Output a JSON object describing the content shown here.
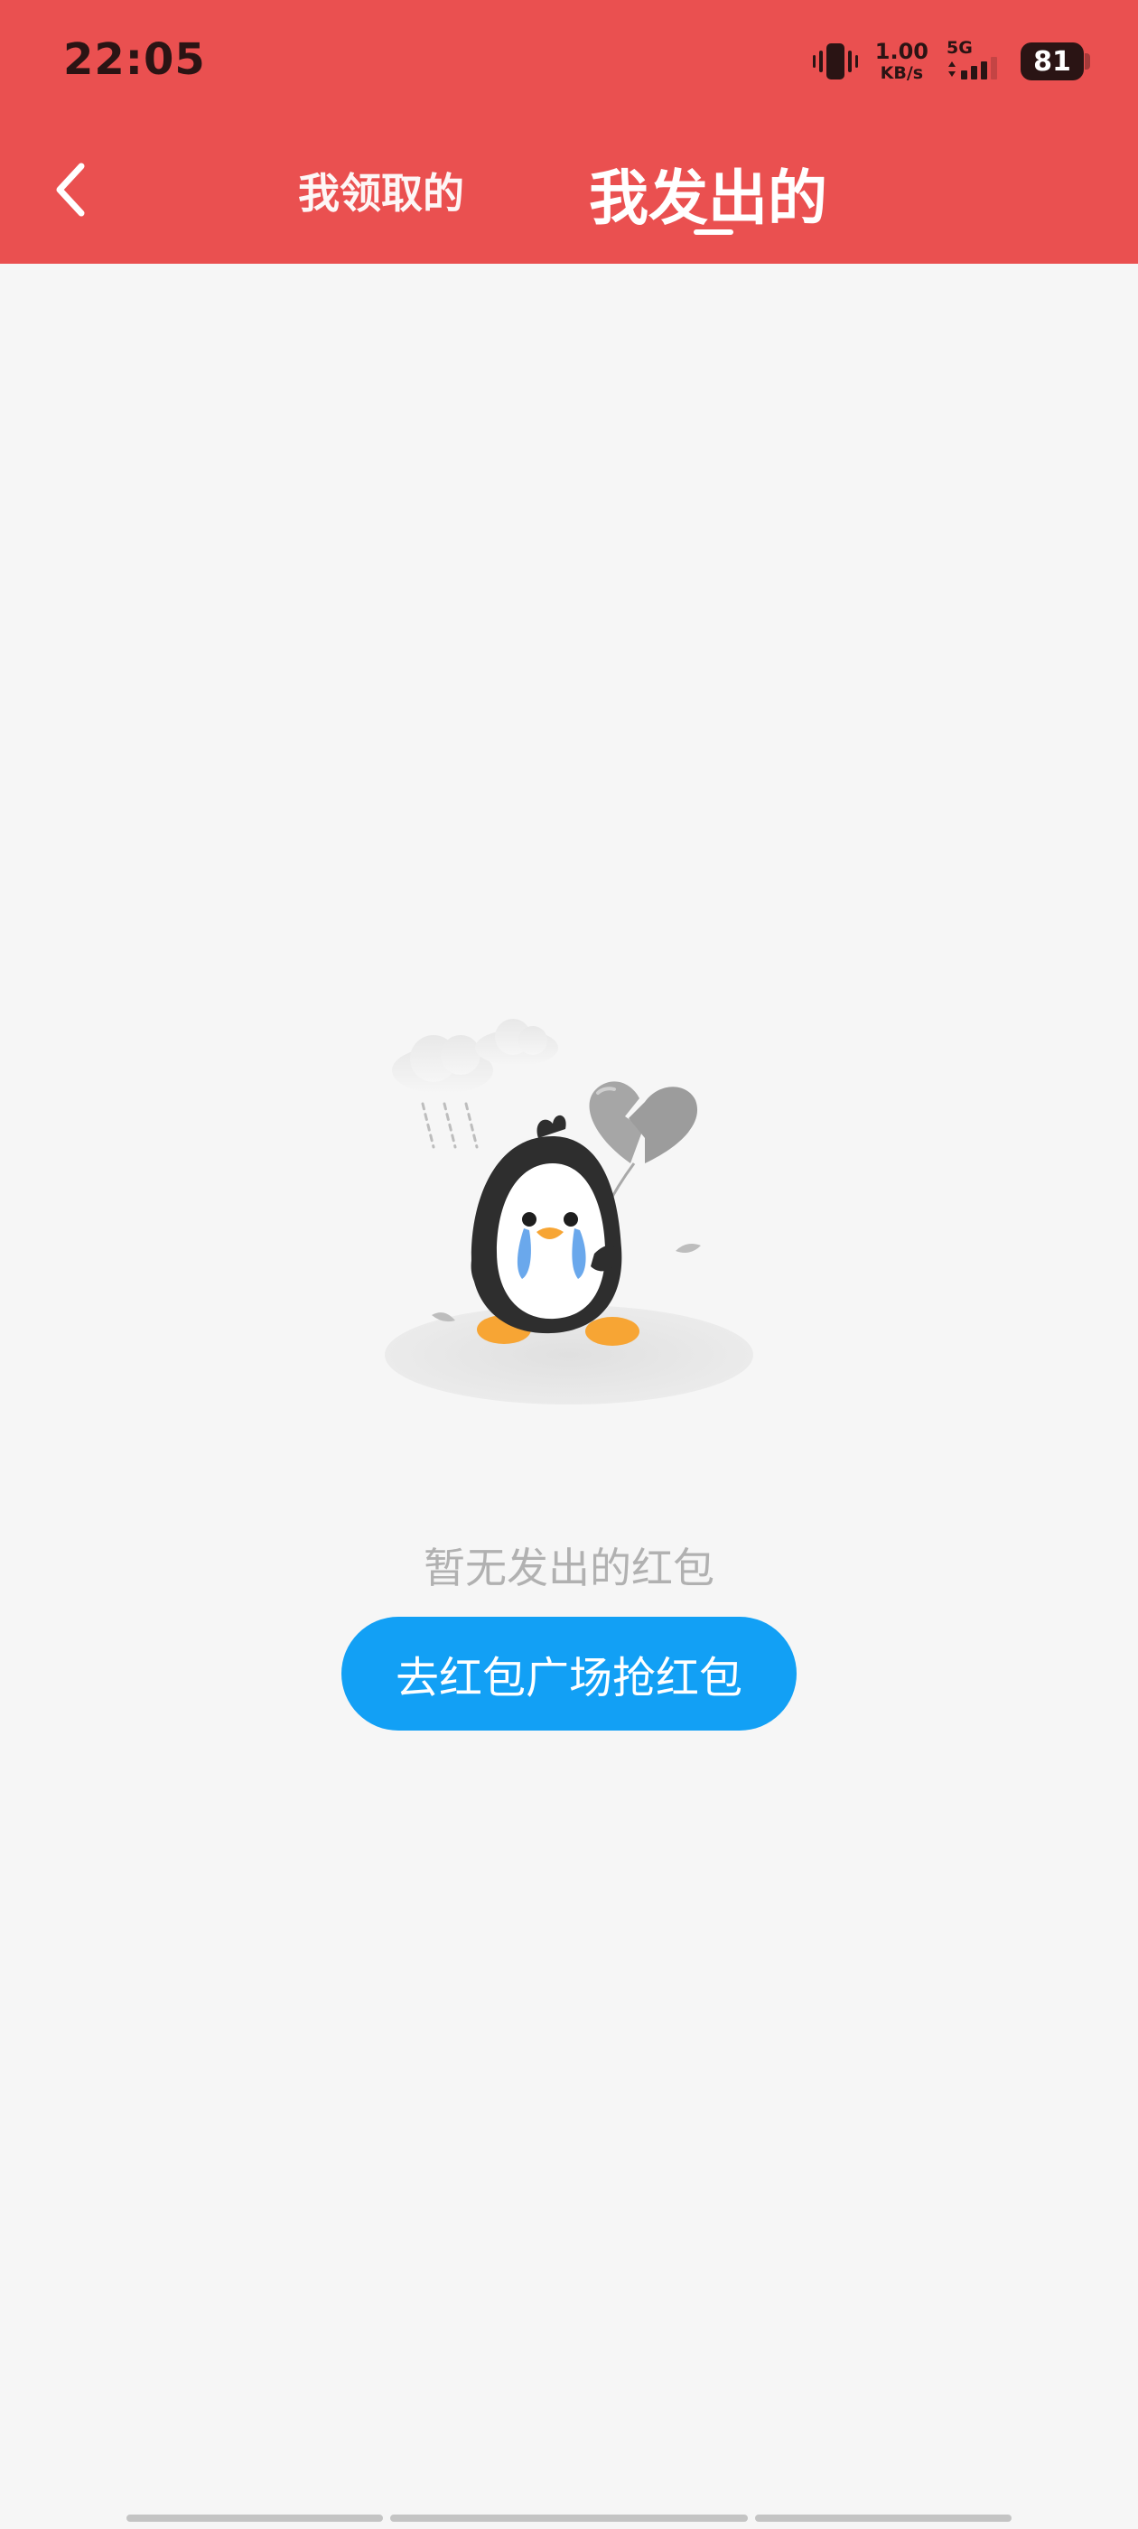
{
  "status_bar": {
    "time": "22:05",
    "net_speed_value": "1.00",
    "net_speed_unit": "KB/s",
    "network_type": "5G",
    "battery_level": "81"
  },
  "header": {
    "background_color": "#ea5050",
    "back_icon": "chevron-left-icon",
    "tabs": [
      {
        "label": "我领取的",
        "selected": false
      },
      {
        "label": "我发出的",
        "selected": true
      }
    ]
  },
  "empty_state": {
    "illustration_icon": "crying-penguin-broken-heart-illustration",
    "message": "暂无发出的红包",
    "button_label": "去红包广场抢红包",
    "button_color": "#12a0f5"
  }
}
